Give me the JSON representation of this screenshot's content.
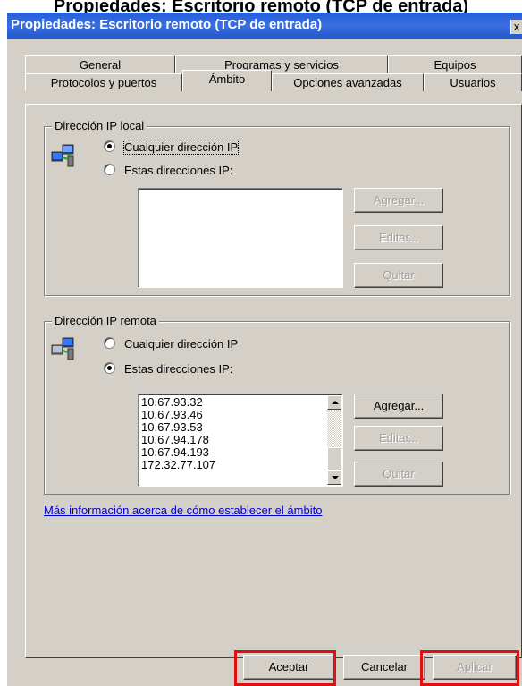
{
  "caption": "Propiedades: Escritorio remoto (TCP de entrada)",
  "window": {
    "title": "Propiedades: Escritorio remoto (TCP de entrada)",
    "close_label": "x"
  },
  "tabs": {
    "row1": [
      "General",
      "Programas y servicios",
      "Equipos"
    ],
    "row2": [
      "Protocolos y puertos",
      "Ámbito",
      "Opciones avanzadas",
      "Usuarios"
    ],
    "selected": "Ámbito"
  },
  "local": {
    "legend": "Dirección IP local",
    "option_any": "Cualquier dirección IP",
    "option_these": "Estas direcciones IP:",
    "selected": "any",
    "addresses": [],
    "add_label": "Agregar...",
    "edit_label": "Editar...",
    "remove_label": "Quitar"
  },
  "remote": {
    "legend": "Dirección IP remota",
    "option_any": "Cualquier dirección IP",
    "option_these": "Estas direcciones IP:",
    "selected": "these",
    "addresses": [
      "10.67.93.32",
      "10.67.93.46",
      "10.67.93.53",
      "10.67.94.178",
      "10.67.94.193",
      "172.32.77.107"
    ],
    "add_label": "Agregar...",
    "edit_label": "Editar...",
    "remove_label": "Quitar"
  },
  "link_text": "Más información acerca de cómo establecer el ámbito",
  "footer": {
    "ok_label": "Aceptar",
    "cancel_label": "Cancelar",
    "apply_label": "Aplicar"
  },
  "highlight_color": "#e01010"
}
